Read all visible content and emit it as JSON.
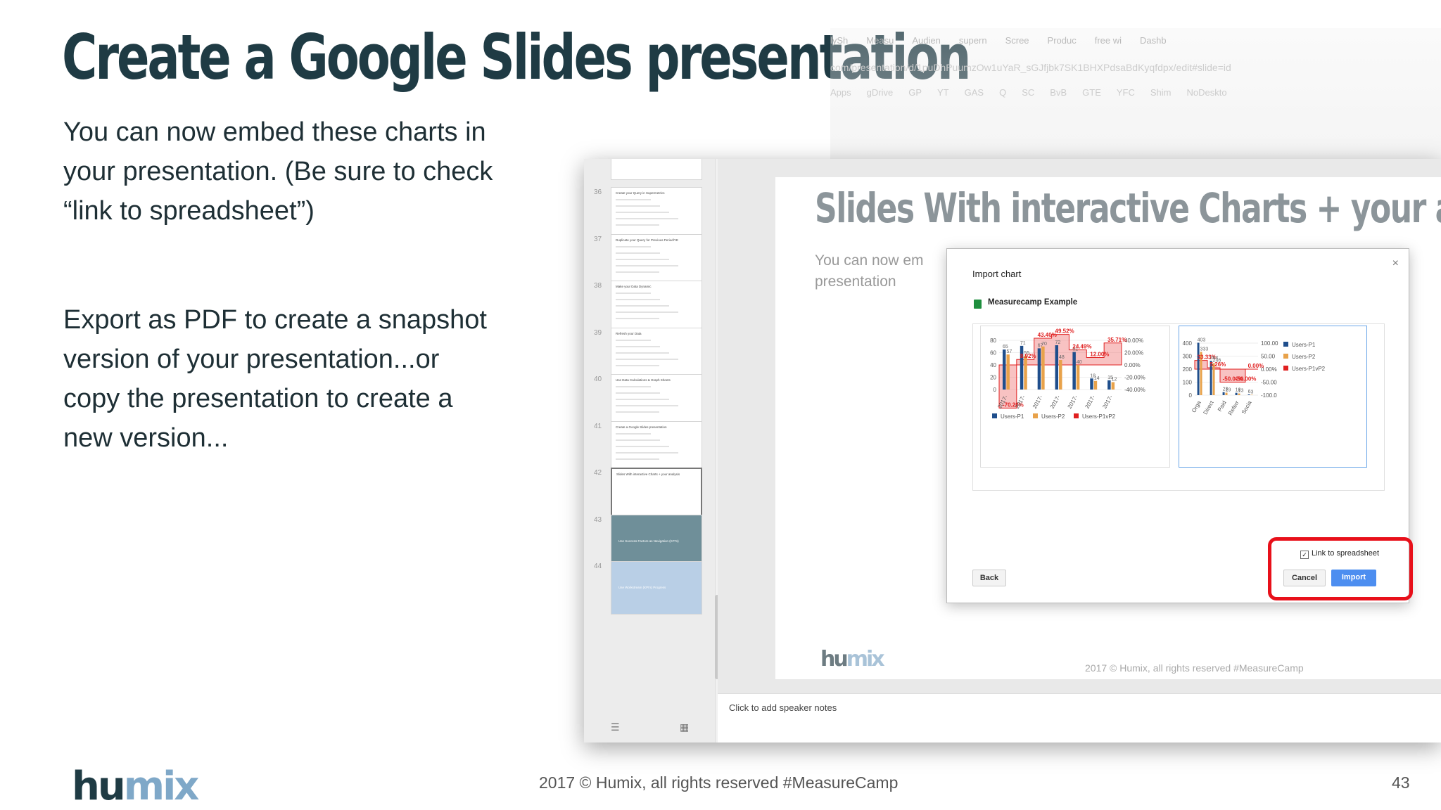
{
  "title": "Create a Google Slides presentation",
  "paragraph1": [
    "You can now embed these charts in",
    "your presentation. (Be sure to check",
    "“link to spreadsheet”)"
  ],
  "paragraph2": [
    "Export as PDF to create a snapshot",
    "version of your presentation...or",
    "copy the presentation to create a",
    "new version..."
  ],
  "logo": {
    "part1": "hu",
    "part2": "mix"
  },
  "footer": {
    "copyright": "2017 © Humix, all rights reserved  #MeasureCamp",
    "page_number": "43"
  },
  "browser": {
    "tabs": [
      "lySh",
      "Measu",
      "Audien",
      "supern",
      "Scree",
      "Produc",
      "free wi",
      "Dashb"
    ],
    "url": "com/presentation/d/1puDhPuumzOw1uYaR_sGJfjbk7SK1BHXPdsaBdKyqfdpx/edit#slide=id",
    "bookmarks": [
      "Apps",
      "gDrive",
      "GP",
      "YT",
      "GAS",
      "Q",
      "SC",
      "BvB",
      "GTE",
      "YFC",
      "Shim",
      "NoDeskto"
    ]
  },
  "thumbnails": [
    {
      "num": "36",
      "title": "Create your Query in Supermetrics"
    },
    {
      "num": "37",
      "title": "Duplicate your Query for Previous Period/YE"
    },
    {
      "num": "38",
      "title": "Make your Data Dynamic"
    },
    {
      "num": "39",
      "title": "Refresh your Data"
    },
    {
      "num": "40",
      "title": "Use Data Calculations & Graph Sheets"
    },
    {
      "num": "41",
      "title": "Create a Google Slides presentation"
    },
    {
      "num": "42",
      "title": "Slides With interactive Charts + your analysis"
    },
    {
      "num": "43",
      "title": "Use Success Factors as Navigation (KPI's)"
    },
    {
      "num": "44",
      "title": "Use Workstream (KPI's) Progress"
    }
  ],
  "slide": {
    "title": "Slides With interactive Charts + your analysis",
    "subtitle": "You can now em presentation",
    "logo_part1": "hu",
    "logo_part2": "mix",
    "footer": "2017 © Humix, all rights reserved  #MeasureCamp"
  },
  "notes_placeholder": "Click to add speaker notes",
  "dialog": {
    "title": "Import chart",
    "close": "×",
    "source": "Measurecamp Example",
    "link_label": "Link to spreadsheet",
    "link_checked": "✓",
    "back_label": "Back",
    "cancel_label": "Cancel",
    "import_label": "Import"
  },
  "colors": {
    "series_p1": "#1f4e8c",
    "series_p2": "#e8a24a",
    "series_p1vp2": "#e02020",
    "highlight": "#e8101a",
    "accent_blue": "#4d8ef0"
  },
  "chart_data": [
    {
      "type": "bar",
      "categories": [
        "2017-",
        "2017-",
        "2017-",
        "2017-",
        "2017-",
        "2017-",
        "2017-"
      ],
      "series": [
        {
          "name": "Users-P1",
          "values": [
            65,
            71,
            67,
            72,
            61,
            18,
            15
          ]
        },
        {
          "name": "Users-P2",
          "values": [
            57,
            55,
            70,
            48,
            40,
            14,
            12
          ]
        },
        {
          "name": "Users-P1vP2",
          "values": [
            -70.2,
            8.92,
            43.4,
            49.52,
            24.49,
            12,
            35.71
          ]
        }
      ],
      "ylim": [
        0,
        80
      ],
      "y2lim": [
        -40,
        40
      ],
      "yticks": [
        "0",
        "20",
        "40",
        "60",
        "80"
      ],
      "y2ticks": [
        "-40.00%",
        "-20.00%",
        "0.00%",
        "20.00%",
        "40.00%"
      ],
      "legend": "bottom"
    },
    {
      "type": "bar",
      "categories": [
        "Orga",
        "Direct",
        "Paid",
        "Referr",
        "Socia"
      ],
      "series": [
        {
          "name": "Users-P1",
          "values": [
            403,
            264,
            23,
            18,
            6
          ]
        },
        {
          "name": "Users-P2",
          "values": [
            333,
            246,
            19,
            13,
            3
          ]
        },
        {
          "name": "Users-P1vP2",
          "values": [
            33.33,
            5.26,
            -50.0,
            -50.0,
            0
          ]
        }
      ],
      "ylim": [
        0,
        400
      ],
      "y2lim": [
        -100,
        100
      ],
      "yticks": [
        "0",
        "100",
        "200",
        "300",
        "400"
      ],
      "y2ticks": [
        "-100.0",
        "-50.00",
        "0.00%",
        "50.00",
        "100.00"
      ],
      "legend": "right"
    }
  ]
}
